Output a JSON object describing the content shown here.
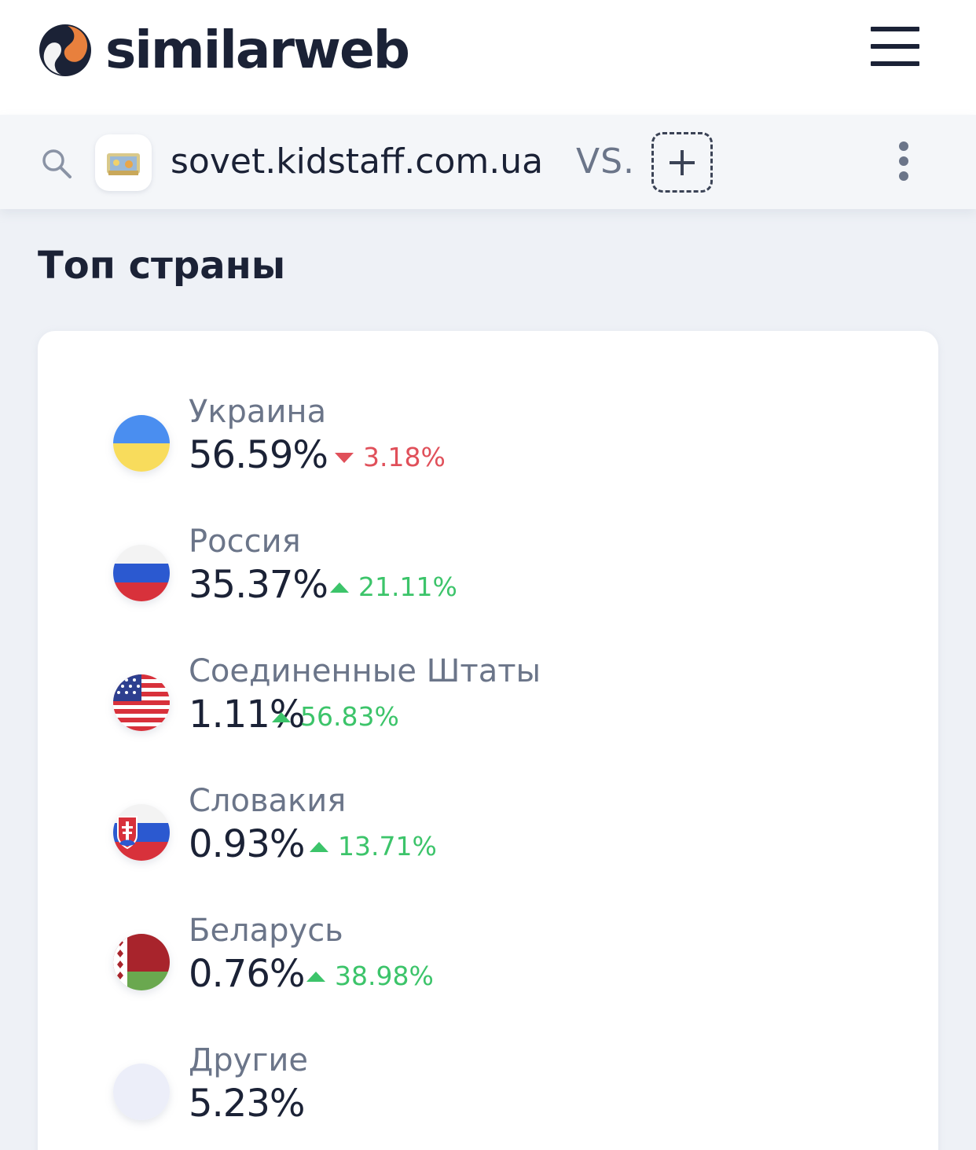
{
  "header": {
    "brand": "similarweb",
    "menu_icon": "hamburger-menu-icon"
  },
  "search": {
    "domain": "sovet.kidstaff.com.ua",
    "vs_label": "VS.",
    "search_icon": "search-icon",
    "add_icon": "plus-icon",
    "more_icon": "kebab-menu-icon"
  },
  "section": {
    "title": "Топ страны"
  },
  "countries": [
    {
      "name": "Украина",
      "share": "56.59%",
      "change": "3.18%",
      "direction": "down",
      "flag_icon": "ukraine-flag-icon"
    },
    {
      "name": "Россия",
      "share": "35.37%",
      "change": "21.11%",
      "direction": "up",
      "flag_icon": "russia-flag-icon"
    },
    {
      "name": "Соединенные Штаты",
      "share": "1.11%",
      "change": "56.83%",
      "direction": "up",
      "flag_icon": "usa-flag-icon"
    },
    {
      "name": "Словакия",
      "share": "0.93%",
      "change": "13.71%",
      "direction": "up",
      "flag_icon": "slovakia-flag-icon"
    },
    {
      "name": "Беларусь",
      "share": "0.76%",
      "change": "38.98%",
      "direction": "up",
      "flag_icon": "belarus-flag-icon"
    },
    {
      "name": "Другие",
      "share": "5.23%",
      "change": "",
      "direction": "",
      "flag_icon": "others-placeholder-icon"
    }
  ],
  "colors": {
    "brand_dark": "#1b2236",
    "brand_orange": "#e8803d",
    "up": "#3cc46a",
    "down": "#e0505a",
    "muted": "#6b7589"
  }
}
